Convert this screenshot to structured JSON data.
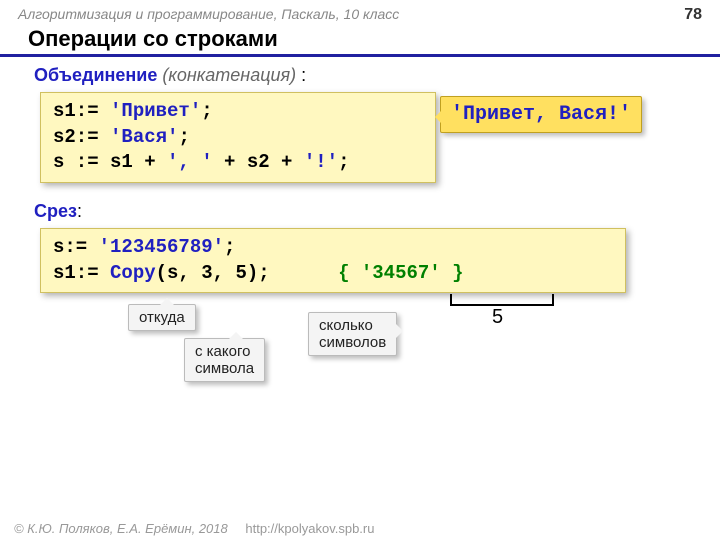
{
  "header": {
    "course": "Алгоритмизация и программирование, Паскаль, 10 класс",
    "page": "78"
  },
  "title": "Операции со строками",
  "section1": {
    "blue": "Объединение",
    "gray": "(конкатенация)",
    "tail": " :",
    "code_l1a": "s1:= ",
    "code_l1b": "'Привет'",
    "code_l1c": ";",
    "code_l2a": "s2:= ",
    "code_l2b": "'Вася'",
    "code_l2c": ";",
    "code_l3a": "s := s1 + ",
    "code_l3b": "', '",
    "code_l3c": " + s2 + ",
    "code_l3d": "'!'",
    "code_l3e": ";",
    "callout": "'Привет, Вася!'"
  },
  "section2": {
    "blue": "Срез",
    "tail": ":",
    "code_l1a": "s:= ",
    "code_l1b": "'123456789'",
    "code_l1c": ";",
    "code_l2a": "s1:= ",
    "code_l2b": "Copy",
    "code_l2c": "(s, 3, 5);",
    "code_l2_cm": "{ '34567' }",
    "note1": "откуда",
    "note2": "с какого\nсимвола",
    "note3": "сколько\nсимволов",
    "bracket_label": "5"
  },
  "footer": {
    "copy": "© К.Ю. Поляков, Е.А. Ерёмин, 2018",
    "url": "http://kpolyakov.spb.ru"
  }
}
